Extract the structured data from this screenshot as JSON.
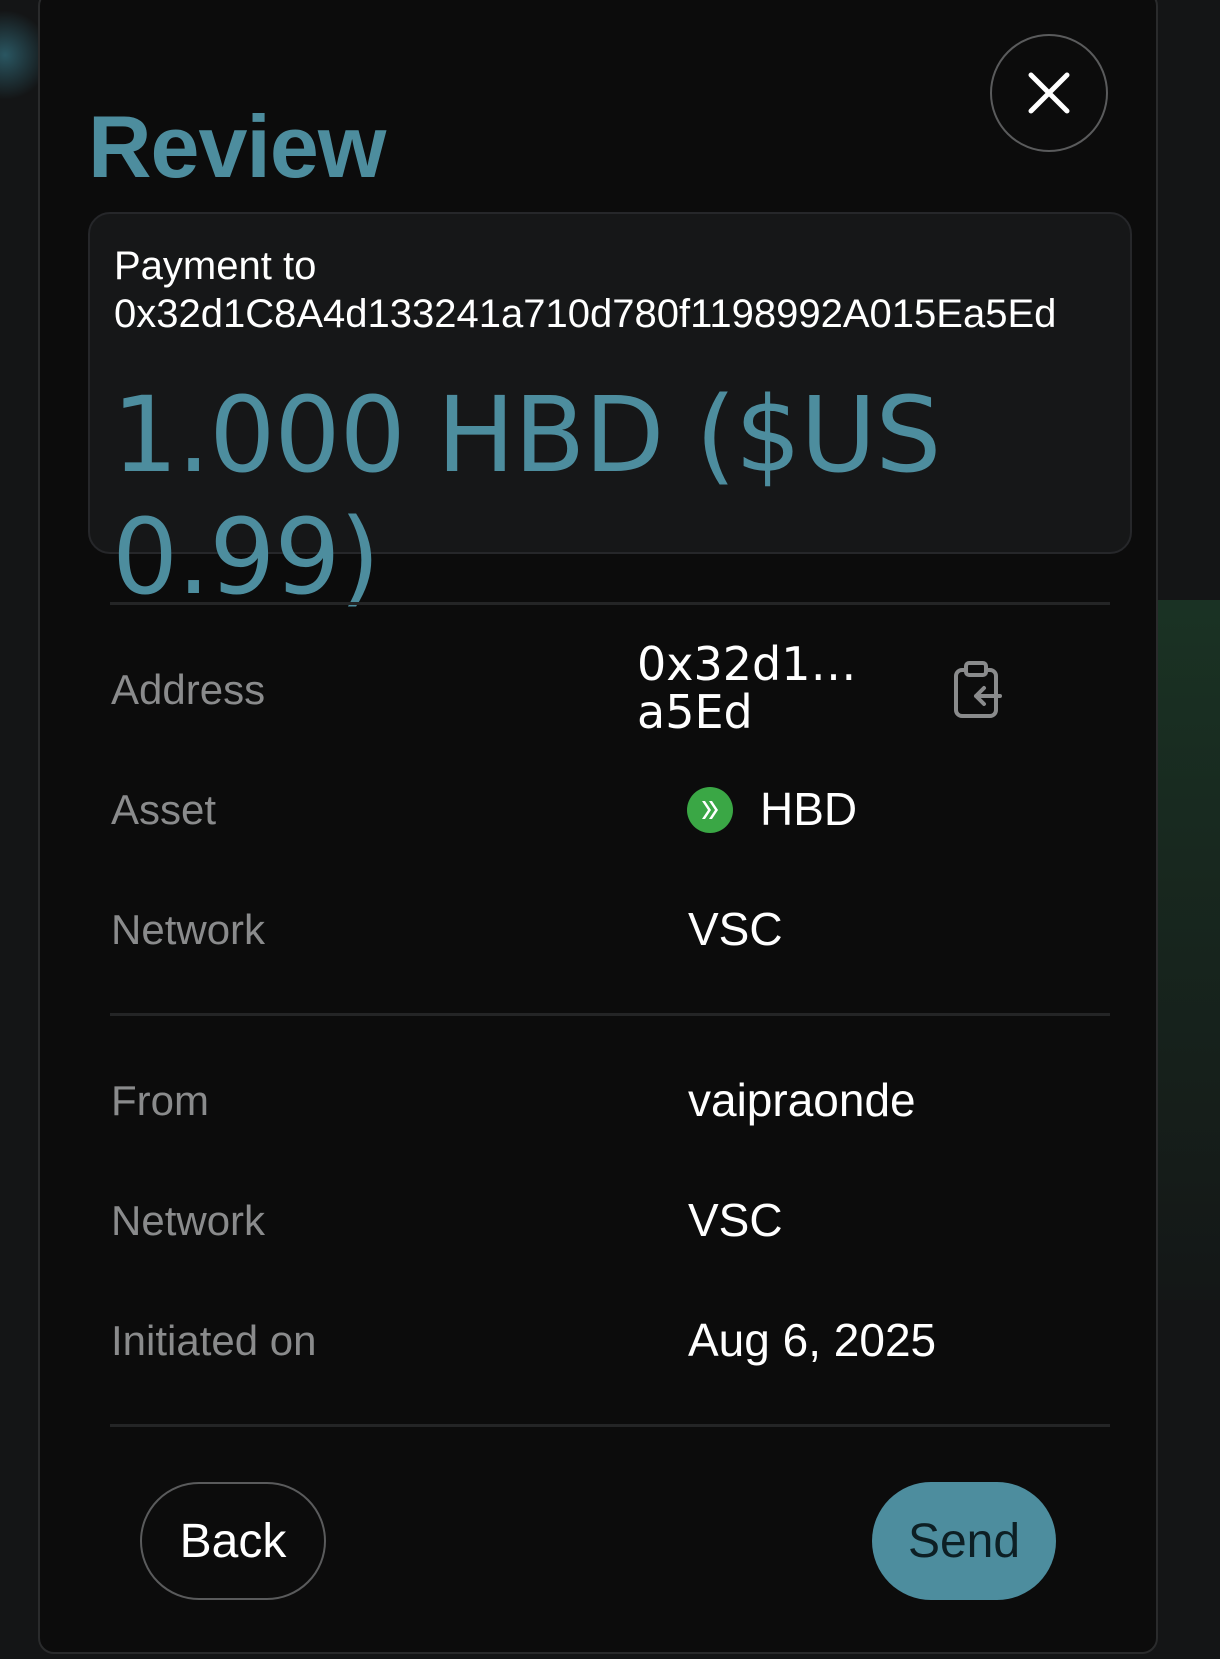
{
  "modal": {
    "title": "Review",
    "close_icon": "close-icon"
  },
  "summary": {
    "payment_to_label": "Payment to",
    "recipient": "0x32d1C8A4d133241a710d780f1198992A015Ea5Ed",
    "amount_text": "1.000 HBD ($US 0.99)"
  },
  "details": {
    "address_label": "Address",
    "address_value_line1": "0x32d1…",
    "address_value_line2": "a5Ed",
    "copy_icon": "clipboard-paste-icon",
    "asset_label": "Asset",
    "asset_value": "HBD",
    "asset_icon": "hive-icon",
    "network_label": "Network",
    "network_value": "VSC",
    "from_label": "From",
    "from_value": "vaipraonde",
    "from_network_label": "Network",
    "from_network_value": "VSC",
    "initiated_label": "Initiated on",
    "initiated_value": "Aug 6, 2025"
  },
  "actions": {
    "back_label": "Back",
    "send_label": "Send"
  },
  "colors": {
    "accent": "#4d8d9e",
    "background": "#0c0c0c",
    "asset_icon_bg": "#3aa745"
  }
}
